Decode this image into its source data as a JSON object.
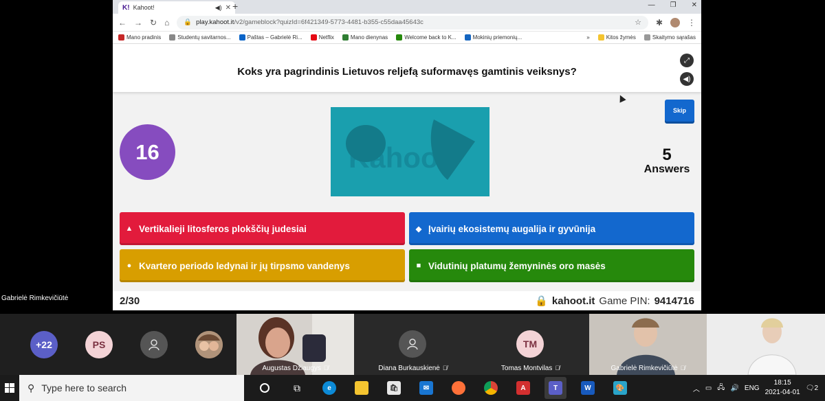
{
  "browser": {
    "tab_title": "Kahoot!",
    "url_host": "play.kahoot.it",
    "url_path": "/v2/gameblock?quizId=6f421349-5773-4481-b355-c55daa45643c",
    "bookmarks": [
      {
        "label": "Mano pradinis",
        "color": "#c62828"
      },
      {
        "label": "Studentų savitarnos...",
        "color": "#888888"
      },
      {
        "label": "Paštas – Gabrielė Ri...",
        "color": "#0a64c8"
      },
      {
        "label": "Netflix",
        "color": "#e50914"
      },
      {
        "label": "Mano dienynas",
        "color": "#2e7d32"
      },
      {
        "label": "Welcome back to K...",
        "color": "#26890c"
      },
      {
        "label": "Mokinių priemonių...",
        "color": "#1565c0"
      }
    ],
    "more_bookmarks": "»",
    "other_bookmarks": "Kitos žymės",
    "reading_list": "Skaitymo sąrašas"
  },
  "kahoot": {
    "question": "Koks yra pagrindinis Lietuvos reljefą suformavęs gamtinis veiksnys?",
    "timer": "16",
    "media_word": "Kahoot!",
    "skip_label": "Skip",
    "answers_count": "5",
    "answers_label": "Answers",
    "answers": [
      {
        "text": "Vertikalieji litosferos plokščių judesiai",
        "color": "#e21b3c",
        "shape": "▲"
      },
      {
        "text": "Įvairių ekosistemų augalija ir gyvūnija",
        "color": "#1368ce",
        "shape": "◆"
      },
      {
        "text": "Kvartero periodo ledynai ir jų tirpsmo vandenys",
        "color": "#d89e00",
        "shape": "●"
      },
      {
        "text": "Vidutinių platumų žemyninės oro masės",
        "color": "#26890c",
        "shape": "■"
      }
    ],
    "progress": "2/30",
    "site": "kahoot.it",
    "pin_label": "Game PIN:",
    "pin": "9414716"
  },
  "meeting": {
    "presenter": "Gabrielė Rimkevičiūtė",
    "participants_more": "+22",
    "avatar_ps": "PS",
    "avatar_tm": "TM",
    "tiles": [
      {
        "name": "Augustas Džiaugys"
      },
      {
        "name": "Diana Burkauskienė"
      },
      {
        "name": "Tomas Montvilas"
      },
      {
        "name": "Gabrielė Rimkevičiūtė"
      }
    ]
  },
  "taskbar": {
    "search_placeholder": "Type here to search",
    "language": "ENG",
    "time": "18:15",
    "date": "2021-04-01",
    "notifications": "2"
  }
}
